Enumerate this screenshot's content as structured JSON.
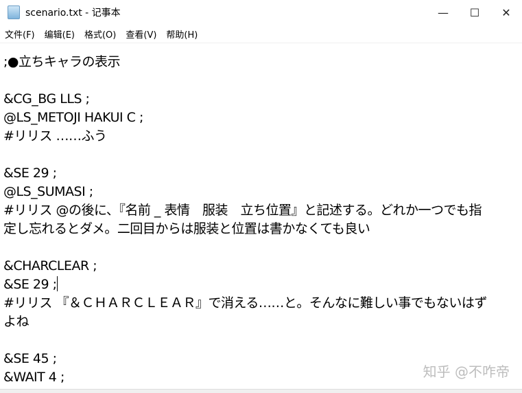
{
  "window": {
    "title": "scenario.txt - 记事本",
    "minimize": "—",
    "maximize": "☐",
    "close": "✕"
  },
  "menu": [
    "文件(F)",
    "编辑(E)",
    "格式(O)",
    "查看(V)",
    "帮助(H)"
  ],
  "lines": [
    ";●立ちキャラの表示",
    "",
    "&CG_BG LLS ;",
    "@LS_METOJI HAKUI C ;",
    "#リリス ……ふう",
    "",
    "&SE 29 ;",
    "@LS_SUMASI ;",
    "#リリス @の後に、『名前 _ 表情　服装　立ち位置』と記述する。どれか一つでも指",
    "定し忘れるとダメ。二回目からは服装と位置は書かなくても良い",
    "",
    "&CHARCLEAR ;",
    "&SE 29 ;",
    "#リリス 『＆ＣＨＡＲＣＬＥＡＲ』で消える……と。そんなに難しい事でもないはず",
    "よね",
    "",
    "&SE 45 ;",
    "&WAIT 4 ;"
  ],
  "watermark": "知乎 @不咋帝"
}
